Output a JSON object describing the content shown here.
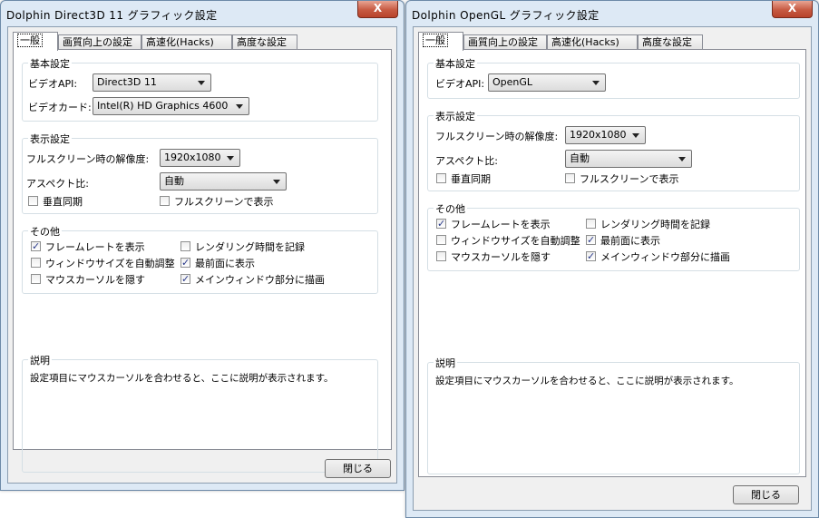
{
  "windows": [
    {
      "title": "Dolphin Direct3D 11 グラフィック設定",
      "close_label": "X",
      "tabs": [
        "一般",
        "画質向上の設定",
        "高速化(Hacks)",
        "高度な設定"
      ],
      "basic_group": {
        "legend": "基本設定",
        "video_api_label": "ビデオAPI:",
        "video_api_value": "Direct3D 11",
        "video_card_label": "ビデオカード:",
        "video_card_value": "Intel(R) HD Graphics 4600"
      },
      "display_group": {
        "legend": "表示設定",
        "fullscreen_res_label": "フルスクリーン時の解像度:",
        "fullscreen_res_value": "1920x1080",
        "aspect_label": "アスペクト比:",
        "aspect_value": "自動",
        "vsync_label": "垂直同期",
        "vsync_checked": false,
        "fullscreen_label": "フルスクリーンで表示",
        "fullscreen_checked": false
      },
      "other_group": {
        "legend": "その他",
        "show_fps_label": "フレームレートを表示",
        "show_fps_checked": true,
        "log_render_time_label": "レンダリング時間を記録",
        "log_render_time_checked": false,
        "auto_window_size_label": "ウィンドウサイズを自動調整",
        "auto_window_size_checked": false,
        "keep_on_top_label": "最前面に表示",
        "keep_on_top_checked": true,
        "hide_cursor_label": "マウスカーソルを隠す",
        "hide_cursor_checked": false,
        "render_to_main_label": "メインウィンドウ部分に描画",
        "render_to_main_checked": true
      },
      "description": {
        "legend": "説明",
        "text": "設定項目にマウスカーソルを合わせると、ここに説明が表示されます。"
      },
      "close_button": "閉じる"
    },
    {
      "title": "Dolphin OpenGL グラフィック設定",
      "close_label": "X",
      "tabs": [
        "一般",
        "画質向上の設定",
        "高速化(Hacks)",
        "高度な設定"
      ],
      "basic_group": {
        "legend": "基本設定",
        "video_api_label": "ビデオAPI:",
        "video_api_value": "OpenGL"
      },
      "display_group": {
        "legend": "表示設定",
        "fullscreen_res_label": "フルスクリーン時の解像度:",
        "fullscreen_res_value": "1920x1080",
        "aspect_label": "アスペクト比:",
        "aspect_value": "自動",
        "vsync_label": "垂直同期",
        "vsync_checked": false,
        "fullscreen_label": "フルスクリーンで表示",
        "fullscreen_checked": false
      },
      "other_group": {
        "legend": "その他",
        "show_fps_label": "フレームレートを表示",
        "show_fps_checked": true,
        "log_render_time_label": "レンダリング時間を記録",
        "log_render_time_checked": false,
        "auto_window_size_label": "ウィンドウサイズを自動調整",
        "auto_window_size_checked": false,
        "keep_on_top_label": "最前面に表示",
        "keep_on_top_checked": true,
        "hide_cursor_label": "マウスカーソルを隠す",
        "hide_cursor_checked": false,
        "render_to_main_label": "メインウィンドウ部分に描画",
        "render_to_main_checked": true
      },
      "description": {
        "legend": "説明",
        "text": "設定項目にマウスカーソルを合わせると、ここに説明が表示されます。"
      },
      "close_button": "閉じる"
    }
  ]
}
